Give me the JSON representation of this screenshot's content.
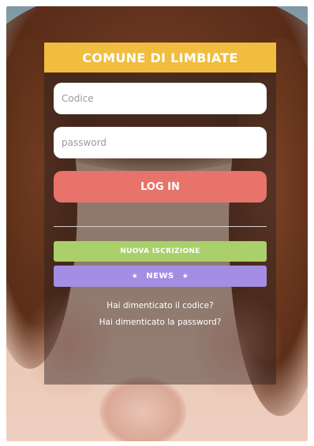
{
  "header": {
    "title": "COMUNE DI LIMBIATE"
  },
  "form": {
    "code_placeholder": "Codice",
    "password_placeholder": "password",
    "login_label": "LOG IN"
  },
  "actions": {
    "new_registration_label": "NUOVA ISCRIZIONE",
    "news_label": "NEWS",
    "news_decoration": "★"
  },
  "links": {
    "forgot_code": "Hai dimenticato il codice?",
    "forgot_password": "Hai dimenticato la password?"
  },
  "colors": {
    "header": "#f0bd3f",
    "login": "#e8736b",
    "new_registration": "#a9d06a",
    "news": "#a48ee3"
  }
}
